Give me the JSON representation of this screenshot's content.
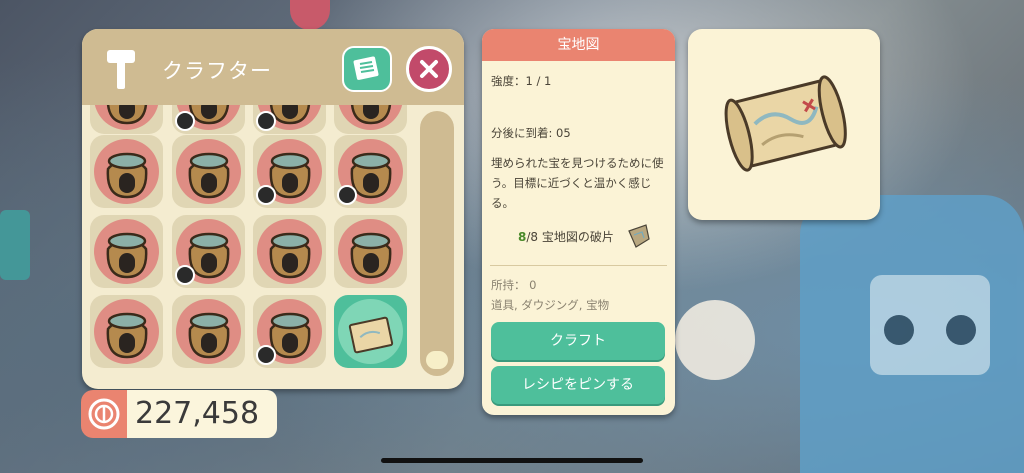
{
  "crafter": {
    "title": "クラフター",
    "recipe_book_icon": "recipe-book-icon",
    "close_icon": "close-icon"
  },
  "grid": {
    "rows": [
      [
        {
          "badge": "none"
        },
        {
          "badge": "leaf"
        },
        {
          "badge": "leaf"
        },
        {
          "badge": "none"
        }
      ],
      [
        {
          "badge": "none"
        },
        {
          "badge": "none"
        },
        {
          "badge": "leaf"
        },
        {
          "badge": "robot"
        }
      ],
      [
        {
          "badge": "none"
        },
        {
          "badge": "robot"
        },
        {
          "badge": "none"
        },
        {
          "badge": "none"
        }
      ],
      [
        {
          "badge": "none"
        },
        {
          "badge": "none"
        },
        {
          "badge": "robot"
        },
        {
          "badge": "none",
          "selected": true,
          "item": "treasure-map"
        }
      ]
    ]
  },
  "currency": {
    "icon": "coin-icon",
    "value": "227,458"
  },
  "detail": {
    "title": "宝地図",
    "strength": "強度：1 / 1",
    "arrival": "分後に到着: 05",
    "description": "埋められた宝を見つけるために使う。目標に近づくと温かく感じる。",
    "req_have": "8",
    "req_rest": "/8 宝地図の破片",
    "owned": "所持： 0",
    "tags": "道具, ダウジング, 宝物",
    "craft_label": "クラフト",
    "pin_label": "レシピをピンする"
  },
  "colors": {
    "accent_green": "#4ebf9b",
    "accent_red": "#c24a6a",
    "panel_header": "#cfbb92",
    "detail_header": "#ea8470"
  }
}
